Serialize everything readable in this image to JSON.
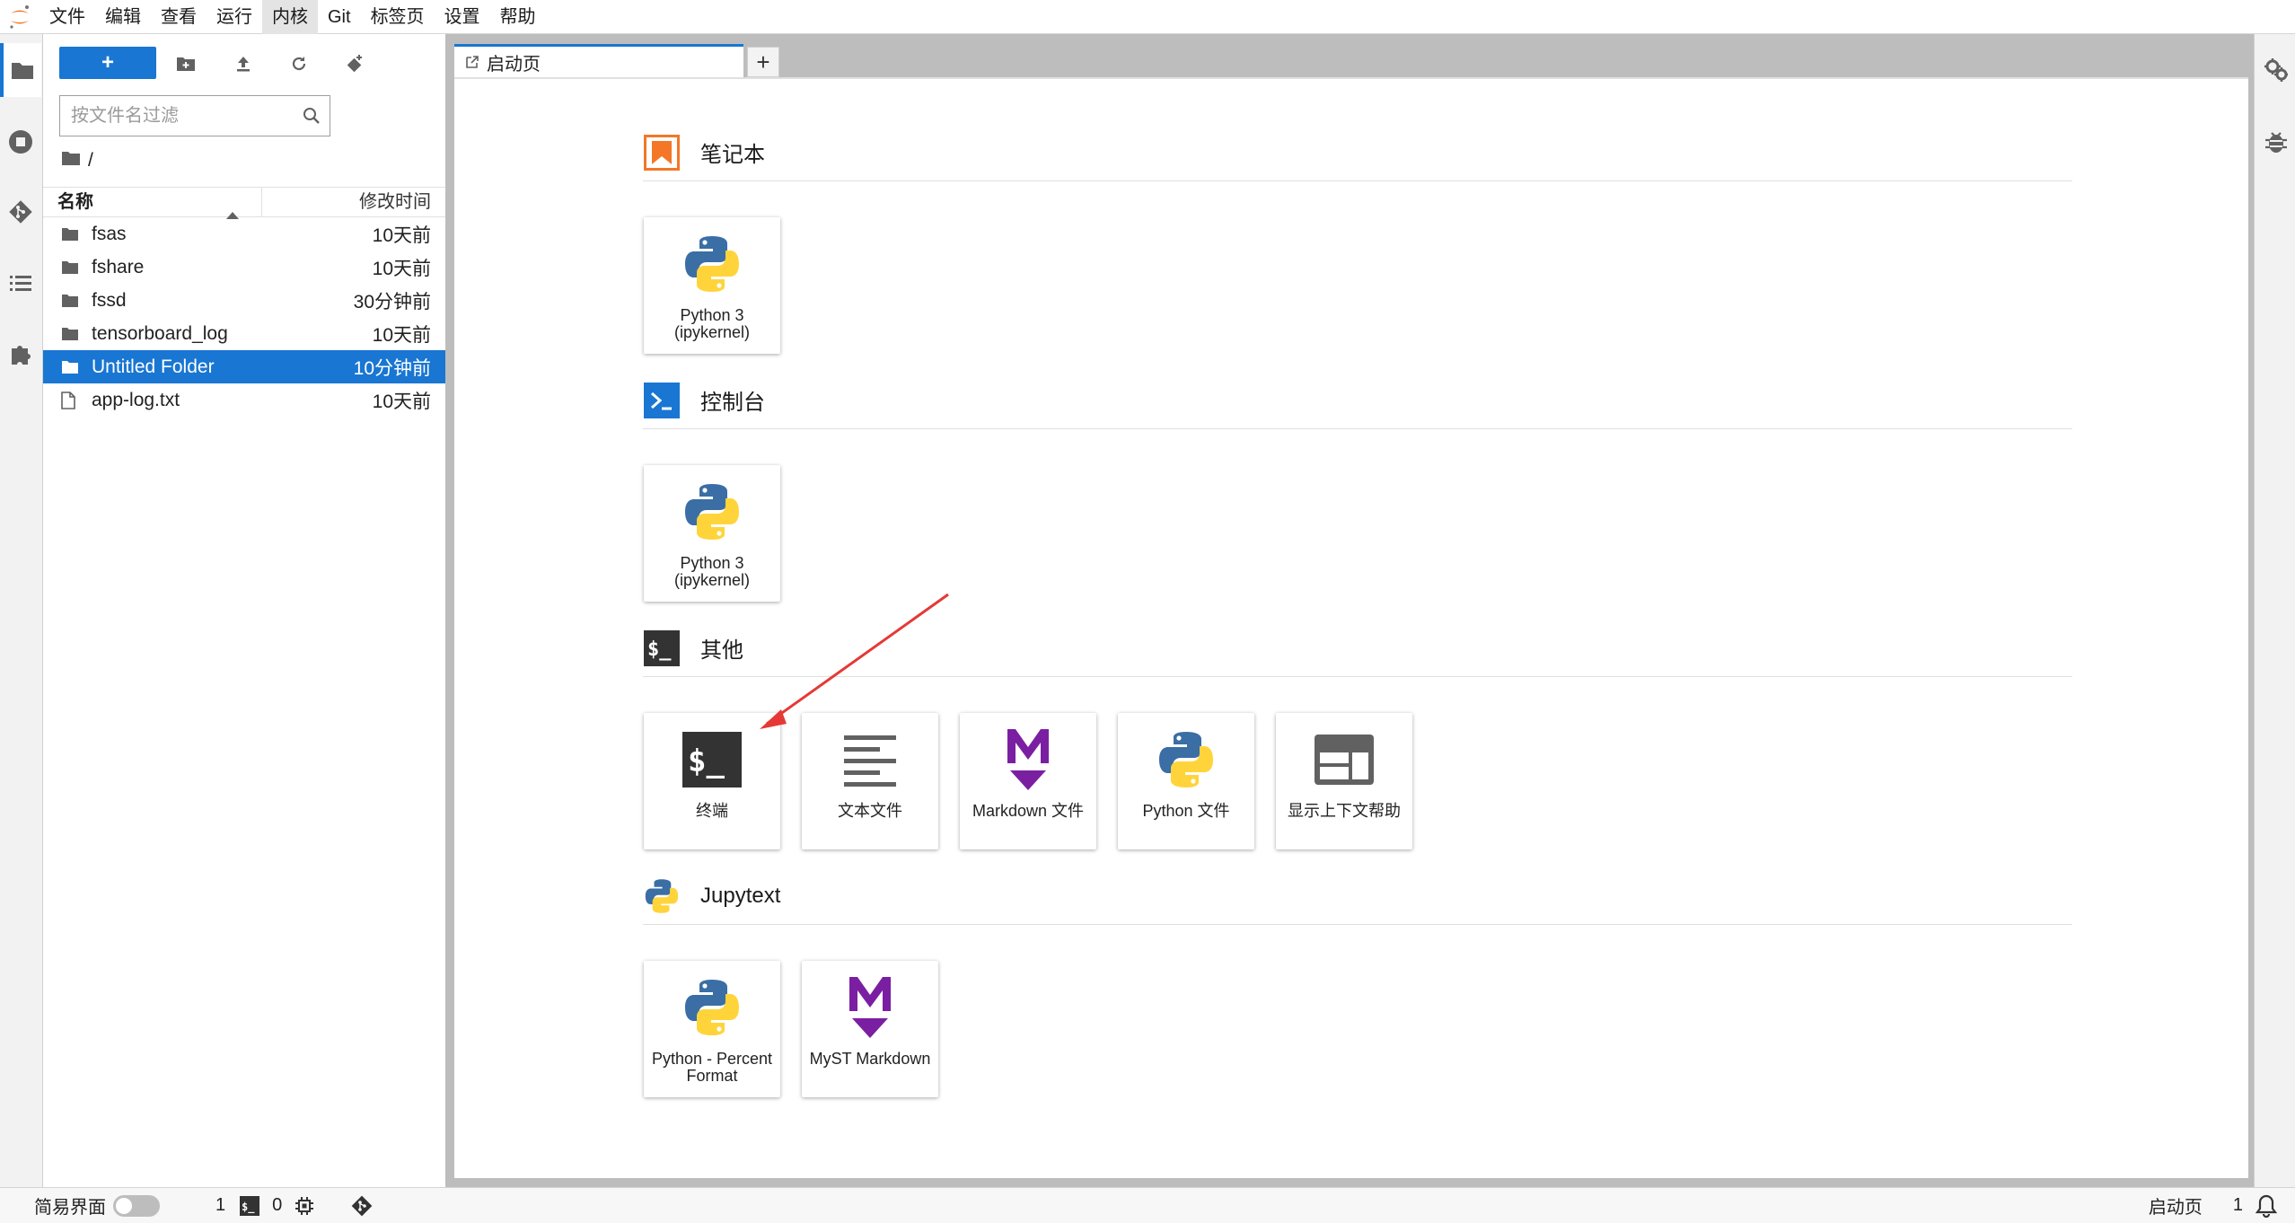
{
  "menubar": {
    "items": [
      "文件",
      "编辑",
      "查看",
      "运行",
      "内核",
      "Git",
      "标签页",
      "设置",
      "帮助"
    ],
    "active_index": 4
  },
  "filebrowser": {
    "new_button_label": "+",
    "search_placeholder": "按文件名过滤",
    "breadcrumb": "/",
    "col_name": "名称",
    "col_modified": "修改时间",
    "files": [
      {
        "name": "fsas",
        "modified": "10天前",
        "type": "folder"
      },
      {
        "name": "fshare",
        "modified": "10天前",
        "type": "folder"
      },
      {
        "name": "fssd",
        "modified": "30分钟前",
        "type": "folder"
      },
      {
        "name": "tensorboard_log",
        "modified": "10天前",
        "type": "folder"
      },
      {
        "name": "Untitled Folder",
        "modified": "10分钟前",
        "type": "folder",
        "selected": true
      },
      {
        "name": "app-log.txt",
        "modified": "10天前",
        "type": "file"
      }
    ]
  },
  "tabs": {
    "launcher_label": "启动页",
    "add_label": "+"
  },
  "launcher": {
    "notebook": {
      "title": "笔记本",
      "cards": [
        {
          "label": "Python 3 (ipykernel)"
        }
      ]
    },
    "console": {
      "title": "控制台",
      "cards": [
        {
          "label": "Python 3 (ipykernel)"
        }
      ]
    },
    "other": {
      "title": "其他",
      "cards": [
        {
          "label": "终端",
          "icon": "terminal-icon",
          "icon_text": "$_"
        },
        {
          "label": "文本文件",
          "icon": "text-file-icon"
        },
        {
          "label": "Markdown 文件",
          "icon": "markdown-icon"
        },
        {
          "label": "Python 文件",
          "icon": "python-icon"
        },
        {
          "label": "显示上下文帮助",
          "icon": "context-help-icon"
        }
      ]
    },
    "jupytext": {
      "title": "Jupytext",
      "cards": [
        {
          "label": "Python - Percent Format",
          "icon": "python-icon"
        },
        {
          "label": "MyST Markdown",
          "icon": "markdown-icon"
        }
      ]
    }
  },
  "statusbar": {
    "simple_mode_label": "简易界面",
    "terminals_count": "1",
    "kernels_count": "0",
    "right_label": "启动页",
    "notification_count": "1"
  },
  "colors": {
    "accent": "#1976d2",
    "notebook_orange": "#f37726",
    "markdown_purple": "#7b1fa2",
    "python_blue": "#3a6ea5",
    "python_yellow": "#ffd43b",
    "annotation_red": "#e53935"
  }
}
